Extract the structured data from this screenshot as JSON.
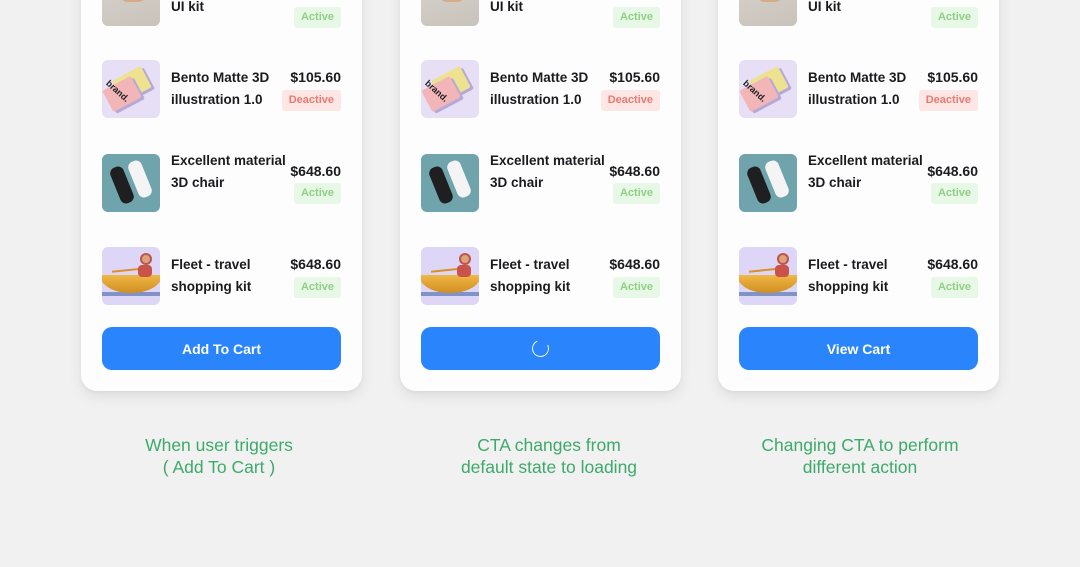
{
  "colors": {
    "background": "#f1f1f1",
    "card": "#fdfdfd",
    "cta": "#2a84fb",
    "active_bg": "#e8f8e6",
    "active_text": "#8fcf86",
    "deactive_bg": "#fde6e4",
    "deactive_text": "#ea7b72",
    "caption": "#3daa6b"
  },
  "products": [
    {
      "name": "UI kit",
      "price": "",
      "status": "Active",
      "thumb": "kit-image"
    },
    {
      "name": "Bento Matte 3D illustration 1.0",
      "price": "$105.60",
      "status": "Deactive",
      "thumb": "brand-cards-image"
    },
    {
      "name": "Excellent material 3D chair",
      "price": "$648.60",
      "status": "Active",
      "thumb": "bottles-image"
    },
    {
      "name": "Fleet - travel shopping kit",
      "price": "$648.60",
      "status": "Active",
      "thumb": "kayak-image"
    }
  ],
  "cards": [
    {
      "state": "default",
      "cta_label": "Add To Cart",
      "caption_line1": "When user triggers",
      "caption_line2": "( Add To Cart )"
    },
    {
      "state": "loading",
      "cta_label": "",
      "cta_icon": "loading-spinner-icon",
      "caption_line1": "CTA changes from",
      "caption_line2": "default state to loading"
    },
    {
      "state": "changed",
      "cta_label": "View Cart",
      "caption_line1": "Changing CTA to perform",
      "caption_line2": "different action"
    }
  ]
}
